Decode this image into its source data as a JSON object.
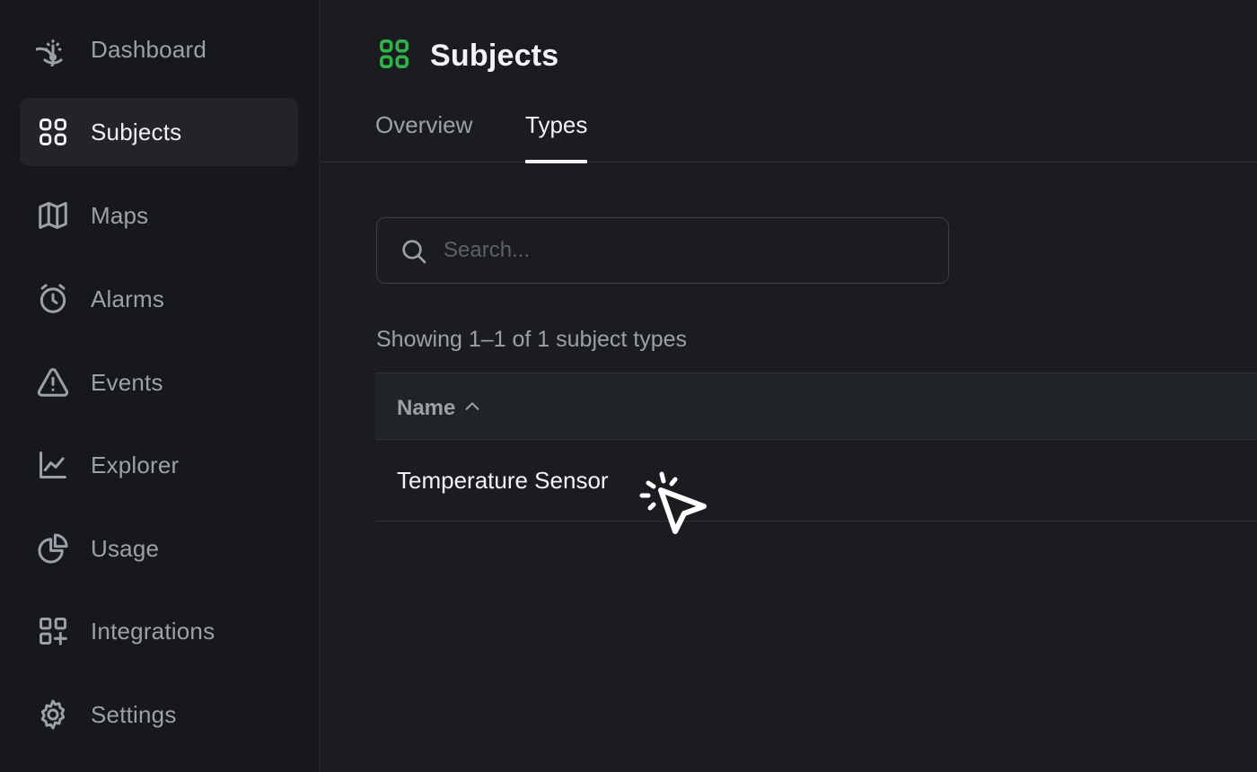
{
  "sidebar": {
    "items": [
      {
        "label": "Dashboard",
        "icon": "gauge-icon",
        "active": false
      },
      {
        "label": "Subjects",
        "icon": "grid-icon",
        "active": true
      },
      {
        "label": "Maps",
        "icon": "map-icon",
        "active": false
      },
      {
        "label": "Alarms",
        "icon": "alarm-clock-icon",
        "active": false
      },
      {
        "label": "Events",
        "icon": "warning-triangle-icon",
        "active": false
      },
      {
        "label": "Explorer",
        "icon": "line-chart-icon",
        "active": false
      },
      {
        "label": "Usage",
        "icon": "pie-chart-icon",
        "active": false
      },
      {
        "label": "Integrations",
        "icon": "grid-plus-icon",
        "active": false
      },
      {
        "label": "Settings",
        "icon": "gear-icon",
        "active": false
      }
    ]
  },
  "header": {
    "title": "Subjects",
    "icon": "grid-icon",
    "accent_color": "#2fb34a"
  },
  "tabs": [
    {
      "label": "Overview",
      "active": false
    },
    {
      "label": "Types",
      "active": true
    }
  ],
  "search": {
    "placeholder": "Search...",
    "value": ""
  },
  "results_summary": "Showing 1–1 of 1 subject types",
  "table": {
    "columns": [
      {
        "label": "Name",
        "sort": "ascending"
      }
    ],
    "rows": [
      {
        "name": "Temperature Sensor"
      }
    ]
  }
}
